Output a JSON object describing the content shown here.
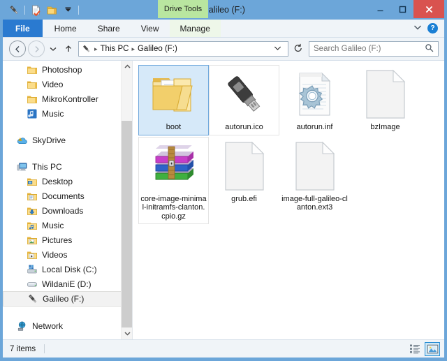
{
  "window": {
    "title": "Galileo (F:)",
    "controls": {
      "minimize": "minimize-button",
      "maximize": "maximize-button",
      "close": "close-button"
    },
    "accent_color": "#6ca6d9",
    "close_color": "#d9534f"
  },
  "quick_access_toolbar": {
    "items": [
      {
        "name": "usb-drive-icon",
        "tooltip": "Galileo (F:)"
      },
      {
        "name": "properties-icon",
        "tooltip": "Properties"
      },
      {
        "name": "new-folder-icon",
        "tooltip": "New folder"
      },
      {
        "name": "chevron-down-icon",
        "tooltip": "Customize Quick Access Toolbar"
      }
    ]
  },
  "contextual_tab": {
    "label": "Drive Tools",
    "color": "#b9e6a0"
  },
  "ribbon": {
    "tabs": [
      {
        "label": "File",
        "selected": true
      },
      {
        "label": "Home",
        "selected": false
      },
      {
        "label": "Share",
        "selected": false
      },
      {
        "label": "View",
        "selected": false
      },
      {
        "label": "Manage",
        "selected": false,
        "contextual": true
      }
    ],
    "minimize_label": "⌄",
    "help_label": "?",
    "file_tab_color": "#2a7ad0"
  },
  "address_bar": {
    "back_label": "←",
    "forward_label": "→",
    "recent_label": "▼",
    "up_label": "↑",
    "drive_icon": "usb-drive-icon",
    "breadcrumb": [
      "This PC",
      "Galileo (F:)"
    ],
    "separator": "▸",
    "dropdown_label": "⌄",
    "refresh_label": "↻"
  },
  "search": {
    "placeholder": "Search Galileo (F:)",
    "value": "",
    "icon": "search-icon"
  },
  "sidebar": {
    "items": [
      {
        "label": "Photoshop",
        "icon": "folder-icon",
        "level": 1,
        "selected": false
      },
      {
        "label": "Video",
        "icon": "folder-icon",
        "level": 1,
        "selected": false
      },
      {
        "label": "MikroKontroller",
        "icon": "folder-icon",
        "level": 1,
        "selected": false
      },
      {
        "label": "Music",
        "icon": "music-library-icon",
        "level": 1,
        "selected": false
      },
      {
        "gap": true
      },
      {
        "label": "SkyDrive",
        "icon": "skydrive-icon",
        "level": 0,
        "selected": false
      },
      {
        "gap": true
      },
      {
        "label": "This PC",
        "icon": "this-pc-icon",
        "level": 0,
        "selected": false
      },
      {
        "label": "Desktop",
        "icon": "desktop-folder-icon",
        "level": 1,
        "selected": false
      },
      {
        "label": "Documents",
        "icon": "documents-folder-icon",
        "level": 1,
        "selected": false
      },
      {
        "label": "Downloads",
        "icon": "downloads-folder-icon",
        "level": 1,
        "selected": false
      },
      {
        "label": "Music",
        "icon": "music-folder-icon",
        "level": 1,
        "selected": false
      },
      {
        "label": "Pictures",
        "icon": "pictures-folder-icon",
        "level": 1,
        "selected": false
      },
      {
        "label": "Videos",
        "icon": "videos-folder-icon",
        "level": 1,
        "selected": false
      },
      {
        "label": "Local Disk (C:)",
        "icon": "system-drive-icon",
        "level": 1,
        "selected": false
      },
      {
        "label": "WildaniE (D:)",
        "icon": "hard-drive-icon",
        "level": 1,
        "selected": false
      },
      {
        "label": "Galileo (F:)",
        "icon": "usb-drive-icon",
        "level": 1,
        "selected": true
      },
      {
        "gap": true
      },
      {
        "label": "Network",
        "icon": "network-icon",
        "level": 0,
        "selected": false
      }
    ],
    "scrollbar": {
      "up_arrow": "▲",
      "down_arrow": "▼"
    }
  },
  "files": [
    {
      "name": "boot",
      "icon": "open-folder-icon",
      "selected": true,
      "framed": false
    },
    {
      "name": "autorun.ico",
      "icon": "usb-drive-icon",
      "selected": false,
      "framed": true
    },
    {
      "name": "autorun.inf",
      "icon": "inf-setup-information-icon",
      "selected": false,
      "framed": false
    },
    {
      "name": "bzImage",
      "icon": "blank-document-icon",
      "selected": false,
      "framed": false
    },
    {
      "name": "core-image-minimal-initramfs-clanton.cpio.gz",
      "icon": "winrar-archive-icon",
      "selected": false,
      "framed": true
    },
    {
      "name": "grub.efi",
      "icon": "blank-document-icon",
      "selected": false,
      "framed": false
    },
    {
      "name": "image-full-galileo-clanton.ext3",
      "icon": "blank-document-icon",
      "selected": false,
      "framed": false
    }
  ],
  "status_bar": {
    "item_count": "7 items",
    "views": [
      {
        "name": "details-view-button",
        "active": false
      },
      {
        "name": "large-icons-view-button",
        "active": true
      }
    ]
  }
}
